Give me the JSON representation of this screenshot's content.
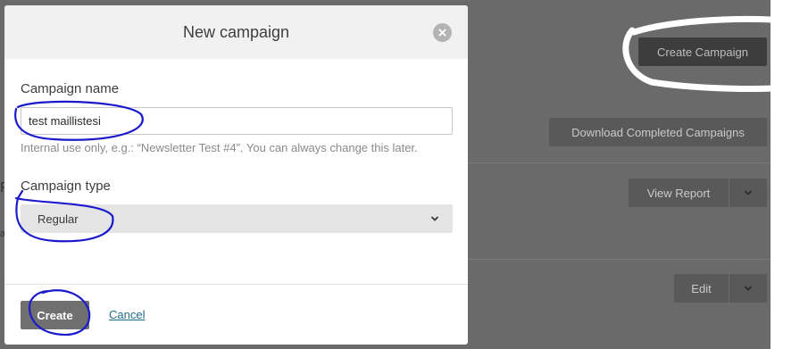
{
  "background": {
    "create_campaign_button": "Create Campaign",
    "download_button": "Download Completed Campaigns",
    "view_report_button": "View Report",
    "edit_button": "Edit"
  },
  "modal": {
    "title": "New campaign",
    "name_label": "Campaign name",
    "name_value": "test maillistesi",
    "name_help": "Internal use only, e.g.: “Newsletter Test #4”. You can always change this later.",
    "type_label": "Campaign type",
    "type_selected": "Regular",
    "create_label": "Create",
    "cancel_label": "Cancel"
  },
  "colors": {
    "annotation": "#1a1acc",
    "backdrop": "#6a6a6a",
    "link": "#1f6b8a"
  },
  "icons": {
    "close": "close-icon",
    "chevron": "chevron-down-icon"
  }
}
